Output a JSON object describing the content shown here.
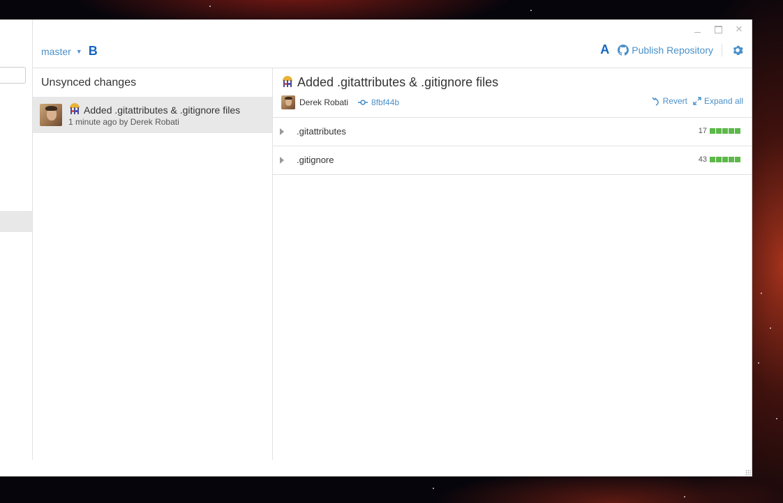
{
  "branch": {
    "name": "master",
    "letter": "B"
  },
  "toolbar": {
    "letter": "A",
    "publish_label": "Publish Repository"
  },
  "changes": {
    "title": "Unsynced changes",
    "items": [
      {
        "title": "Added .gitattributes & .gitignore files",
        "subtitle": "1 minute ago by Derek Robati"
      }
    ]
  },
  "detail": {
    "title": "Added .gitattributes & .gitignore files",
    "author": "Derek Robati",
    "sha": "8fbf44b",
    "revert_label": "Revert",
    "expand_label": "Expand all",
    "files": [
      {
        "name": ".gitattributes",
        "additions": "17"
      },
      {
        "name": ".gitignore",
        "additions": "43"
      }
    ]
  },
  "colors": {
    "accent": "#4a90c9",
    "added": "#5db84b",
    "selected_bg": "#e8e8e8",
    "letter_blue": "#1565c0"
  }
}
